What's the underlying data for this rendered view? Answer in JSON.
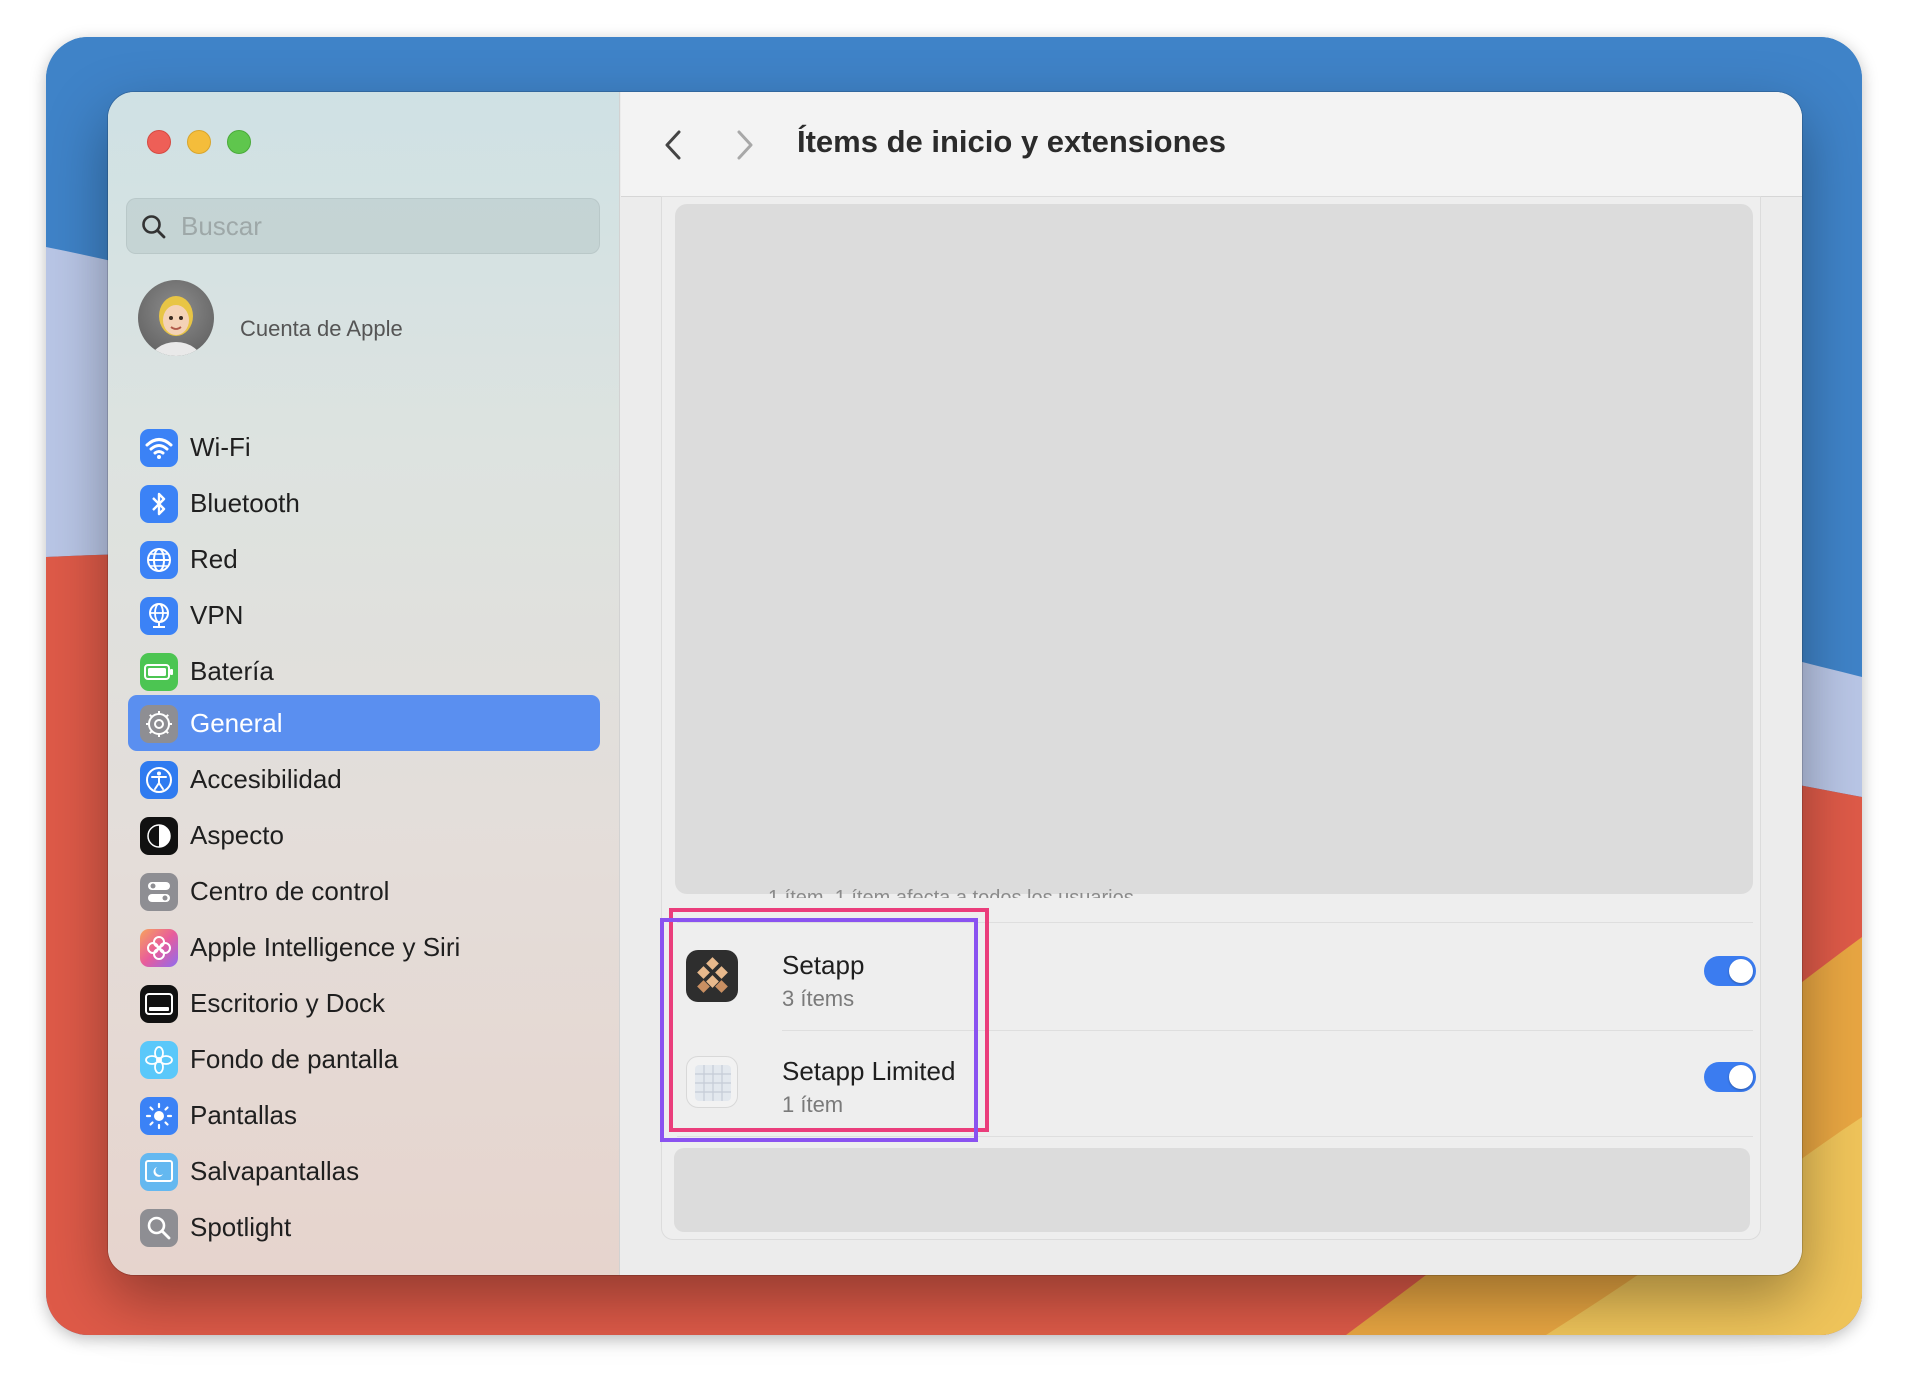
{
  "colors": {
    "accent": "#5a8ff0",
    "toggle_on": "#3b7cf0",
    "highlight_pink": "#ea3d7b",
    "highlight_purple": "#8a52f0"
  },
  "search": {
    "placeholder": "Buscar"
  },
  "account": {
    "label": "Cuenta de Apple"
  },
  "sidebar": {
    "items": [
      {
        "label": "Wi-Fi",
        "icon": "wifi-icon"
      },
      {
        "label": "Bluetooth",
        "icon": "bluetooth-icon"
      },
      {
        "label": "Red",
        "icon": "globe-icon"
      },
      {
        "label": "VPN",
        "icon": "vpn-globe-icon"
      },
      {
        "label": "Batería",
        "icon": "battery-icon"
      },
      {
        "label": "General",
        "icon": "gear-icon",
        "selected": true
      },
      {
        "label": "Accesibilidad",
        "icon": "accessibility-icon"
      },
      {
        "label": "Aspecto",
        "icon": "appearance-icon"
      },
      {
        "label": "Centro de control",
        "icon": "control-center-icon"
      },
      {
        "label": "Apple Intelligence y Siri",
        "icon": "siri-icon"
      },
      {
        "label": "Escritorio y Dock",
        "icon": "desktop-dock-icon"
      },
      {
        "label": "Fondo de pantalla",
        "icon": "wallpaper-flower-icon"
      },
      {
        "label": "Pantallas",
        "icon": "displays-sun-icon"
      },
      {
        "label": "Salvapantallas",
        "icon": "screensaver-icon"
      },
      {
        "label": "Spotlight",
        "icon": "spotlight-search-icon"
      }
    ]
  },
  "toolbar": {
    "title": "Ítems de inicio y extensiones"
  },
  "hidden_row_desc": "1 ítem, 1 ítem afecta a todos los usuarios",
  "apps": [
    {
      "name": "Setapp",
      "sub": "3 ítems",
      "enabled": true,
      "icon": "setapp-icon"
    },
    {
      "name": "Setapp Limited",
      "sub": "1 ítem",
      "enabled": true,
      "icon": "setapp-limited-icon"
    }
  ]
}
